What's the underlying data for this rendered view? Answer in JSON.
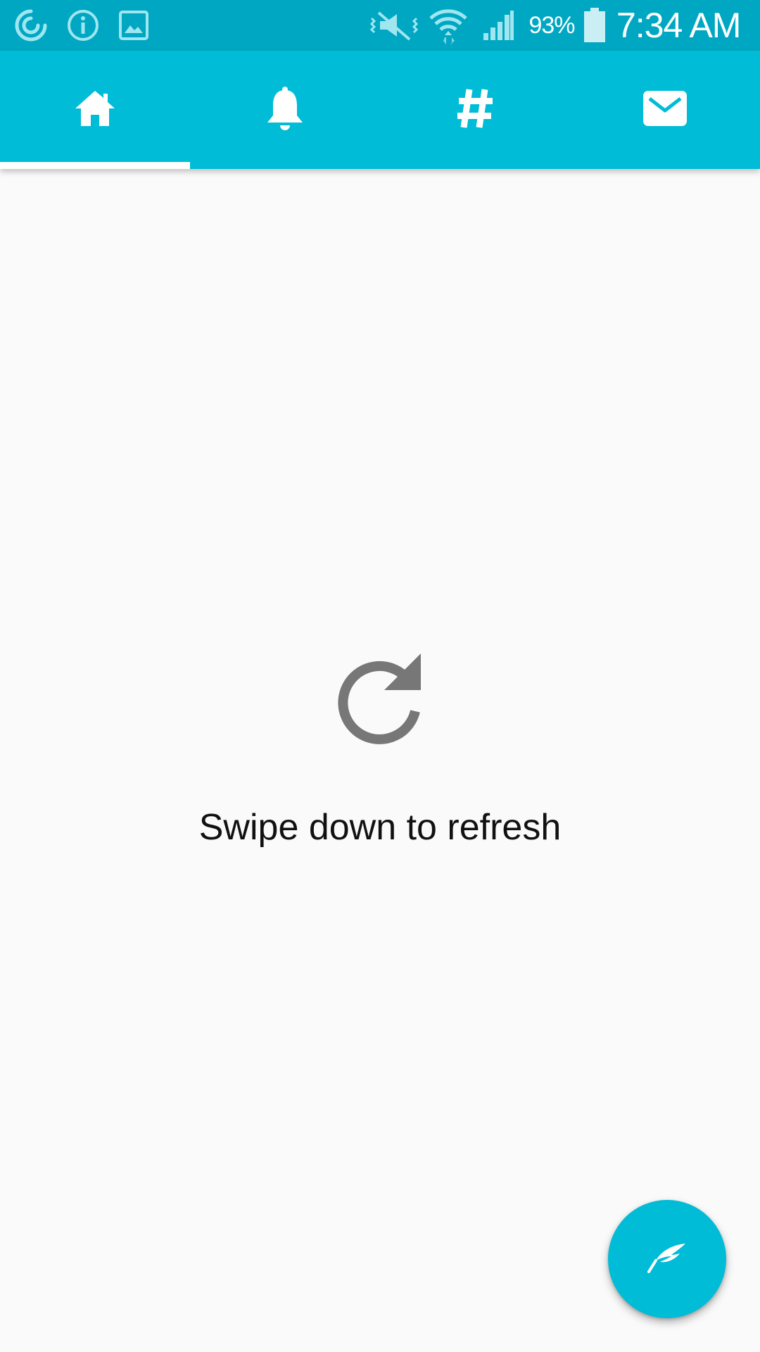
{
  "status_bar": {
    "left_icons": [
      "sync-icon",
      "info-icon",
      "image-icon"
    ],
    "right_icons": [
      "vibrate-mute-icon",
      "wifi-icon",
      "cell-signal-icon",
      "battery-icon"
    ],
    "battery_percent": "93%",
    "time": "7:34 AM",
    "background_color": "#00a7c2"
  },
  "tabs": [
    {
      "name": "home",
      "icon": "home-icon",
      "selected": true
    },
    {
      "name": "notifications",
      "icon": "bell-icon",
      "selected": false
    },
    {
      "name": "hashtags",
      "icon": "hashtag-icon",
      "selected": false
    },
    {
      "name": "messages",
      "icon": "mail-icon",
      "selected": false
    }
  ],
  "theme": {
    "accent": "#00bcd6",
    "indicator": "#ffffff",
    "background": "#fafafa",
    "empty_icon_color": "#777777"
  },
  "empty_state": {
    "icon": "refresh-icon",
    "message": "Swipe down to refresh"
  },
  "fab": {
    "icon": "feather-icon"
  }
}
